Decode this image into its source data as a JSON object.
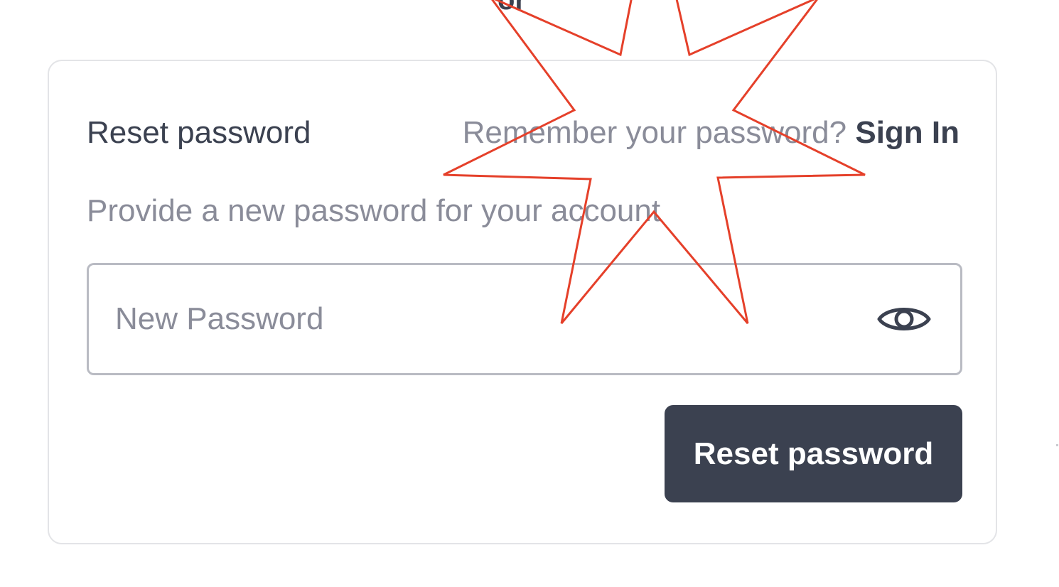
{
  "header": {
    "partial_text": "or"
  },
  "card": {
    "title": "Reset password",
    "signin_prompt": "Remember your password?",
    "signin_link": "Sign In",
    "subtitle": "Provide a new password for your account",
    "password_field": {
      "placeholder": "New Password",
      "value": "",
      "toggle_icon": "eye-icon"
    },
    "submit_label": "Reset password"
  },
  "overlay": {
    "shape": "starburst",
    "color": "#e5402a"
  },
  "colors": {
    "primary": "#3b4150",
    "muted_text": "#8a8c99",
    "border": "#e3e4e7",
    "input_border": "#b9bbc3"
  }
}
